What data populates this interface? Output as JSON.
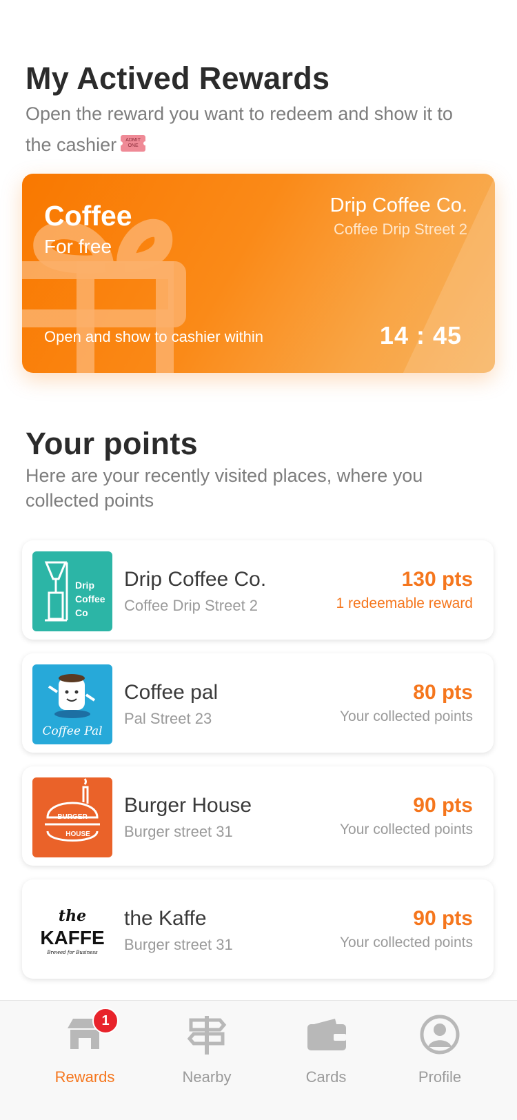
{
  "rewards": {
    "title": "My Actived Rewards",
    "subtitle": "Open the reward you want to redeem and show it to the cashier",
    "subtitle_icon": "ticket-icon",
    "card": {
      "reward_name": "Coffee",
      "reward_desc": "For free",
      "merchant_name": "Drip Coffee Co.",
      "merchant_street": "Coffee Drip Street 2",
      "hint": "Open and show to cashier within",
      "timer": "14 : 45",
      "icon": "gift-icon"
    }
  },
  "points": {
    "title": "Your points",
    "subtitle": "Here are your recently visited places, where you collected points",
    "places": [
      {
        "name": "Drip Coffee Co.",
        "street": "Coffee Drip Street 2",
        "points": "130 pts",
        "note": "1 redeemable reward",
        "logo_text": [
          "Drip",
          "Coffee",
          "Co"
        ],
        "logo_color": "#2cb5a6"
      },
      {
        "name": "Coffee pal",
        "street": "Pal Street 23",
        "points": "80 pts",
        "note": "Your collected points",
        "logo_text": "Coffee Pal",
        "logo_color": "#27a9d9"
      },
      {
        "name": "Burger House",
        "street": "Burger street 31",
        "points": "90 pts",
        "note": "Your collected points",
        "logo_text": [
          "BURGER",
          "HOUSE"
        ],
        "logo_color": "#ea6229"
      },
      {
        "name": "the Kaffe",
        "street": "Burger street 31",
        "points": "90 pts",
        "note": "Your collected points",
        "logo_text": [
          "the",
          "KAFFE",
          "Brewed for Business"
        ],
        "logo_color": "#ffffff"
      }
    ]
  },
  "tabbar": {
    "tabs": [
      {
        "label": "Rewards",
        "icon": "store-icon",
        "active": true,
        "badge": "1"
      },
      {
        "label": "Nearby",
        "icon": "signpost-icon",
        "active": false
      },
      {
        "label": "Cards",
        "icon": "wallet-icon",
        "active": false
      },
      {
        "label": "Profile",
        "icon": "profile-icon",
        "active": false
      }
    ]
  },
  "colors": {
    "accent": "#f5761d",
    "card_gradient_start": "#f97800",
    "card_gradient_end": "#f7b25e",
    "badge": "#e8232b"
  }
}
